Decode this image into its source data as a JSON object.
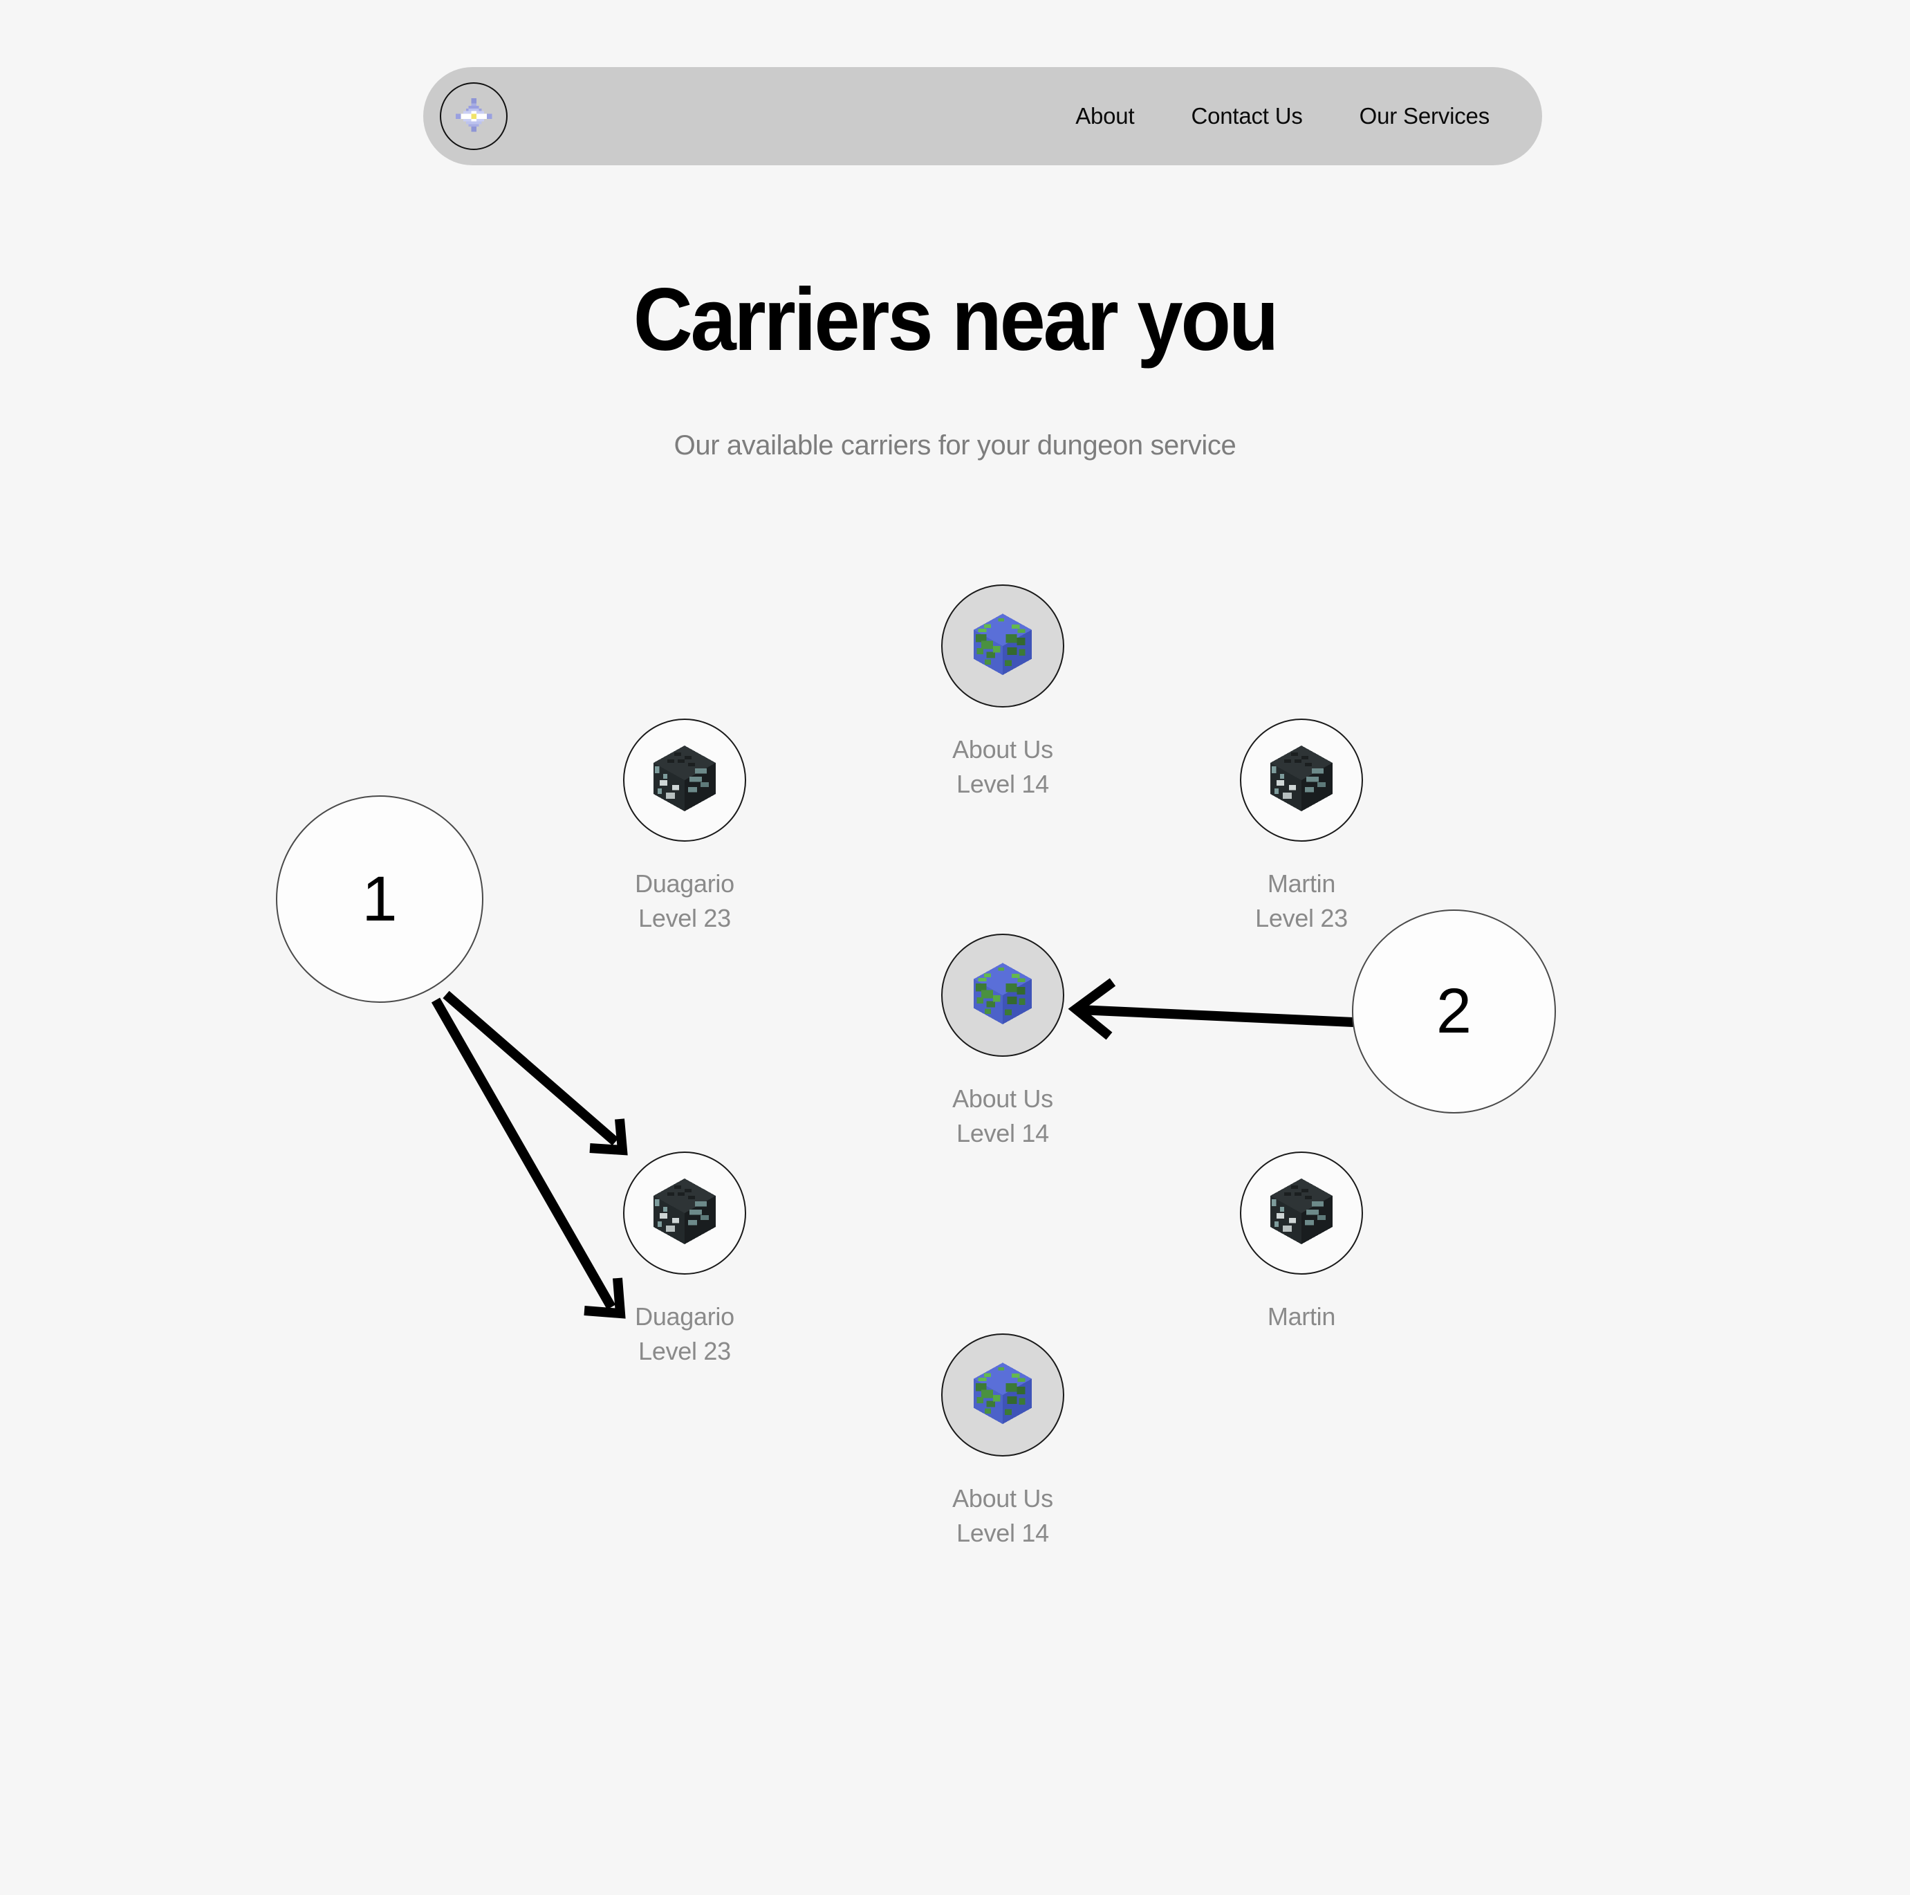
{
  "navbar": {
    "logo_icon": "nether-star-icon",
    "links": [
      {
        "label": "About"
      },
      {
        "label": "Contact Us"
      },
      {
        "label": "Our Services"
      }
    ]
  },
  "header": {
    "title": "Carriers near you",
    "subtitle": "Our available carriers for your dungeon service"
  },
  "carriers": [
    {
      "name": "Duagario",
      "level": "Level 23",
      "avatar": "wither-skull-icon",
      "bg": "plain-bg"
    },
    {
      "name": "About Us",
      "level": "Level 14",
      "avatar": "earth-cube-icon",
      "bg": "earth-bg"
    },
    {
      "name": "Martin",
      "level": "Level 23",
      "avatar": "wither-skull-icon",
      "bg": "plain-bg"
    },
    {
      "name": "Duagario",
      "level": "Level 23",
      "avatar": "wither-skull-icon",
      "bg": "plain-bg"
    },
    {
      "name": "About Us",
      "level": "Level 14",
      "avatar": "earth-cube-icon",
      "bg": "earth-bg"
    },
    {
      "name": "Martin",
      "level": "",
      "avatar": "wither-skull-icon",
      "bg": "plain-bg"
    },
    {
      "name": "About Us",
      "level": "Level 14",
      "avatar": "earth-cube-icon",
      "bg": "earth-bg"
    }
  ],
  "annotations": [
    {
      "number": "1"
    },
    {
      "number": "2"
    }
  ],
  "colors": {
    "page_background": "#f6f6f6",
    "navbar_background": "#cbcbcb",
    "title_text": "#000000",
    "muted_text": "#8a8a8a",
    "annotation_stroke": "#000000",
    "earth_blue": "#5a6fd8",
    "earth_green": "#4f9f4a",
    "skull_dark": "#262b2c",
    "skull_teal": "#7e9c9c",
    "star_purple": "#9aa0e0",
    "star_yellow": "#f0e36a"
  }
}
